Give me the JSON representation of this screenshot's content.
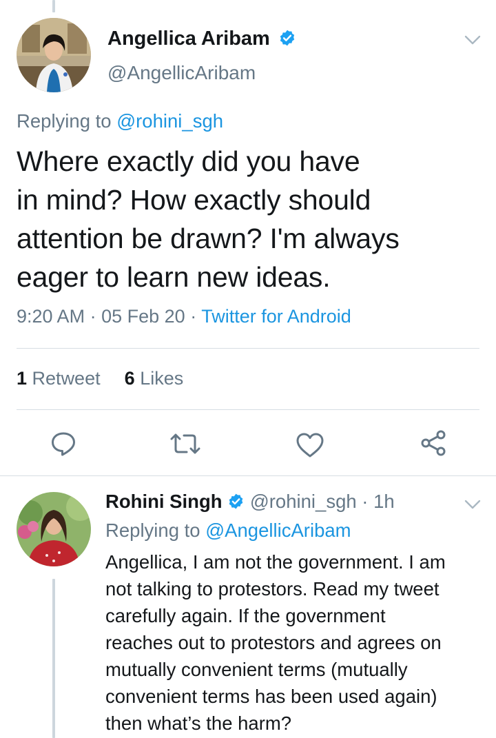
{
  "main_tweet": {
    "author_name": "Angellica Aribam",
    "author_handle": "@AngellicAribam",
    "replying_prefix": "Replying to",
    "replying_to": "@rohini_sgh",
    "text_lines": [
      "Where exactly did you have",
      "in mind? How exactly should",
      "attention be drawn? I'm always",
      "eager to learn new ideas."
    ],
    "time": "9:20 AM",
    "date": "05 Feb 20",
    "source": "Twitter for Android",
    "separator": "·",
    "retweet_count": "1",
    "retweet_label": "Retweet",
    "like_count": "6",
    "like_label": "Likes"
  },
  "reply_tweet": {
    "author_name": "Rohini Singh",
    "author_handle": "@rohini_sgh",
    "time_ago": "· 1h",
    "replying_prefix": "Replying to",
    "replying_to": "@AngellicAribam",
    "text_lines": [
      "Angellica, I am not the government. I am",
      "not talking to protestors. Read my tweet",
      "carefully again. If the government",
      "reaches out to protestors and agrees on",
      "mutually convenient terms (mutually",
      "convenient terms has been used again)",
      "then what’s the harm?"
    ]
  },
  "icons": [
    "chevron-down-icon",
    "verified-badge-icon",
    "reply-icon",
    "retweet-icon",
    "like-icon",
    "share-icon"
  ],
  "colors": {
    "link": "#1b95e0",
    "secondary_text": "#657786",
    "primary_text": "#14171a",
    "verified": "#1da1f2",
    "thread_line": "#cdd6dd"
  }
}
